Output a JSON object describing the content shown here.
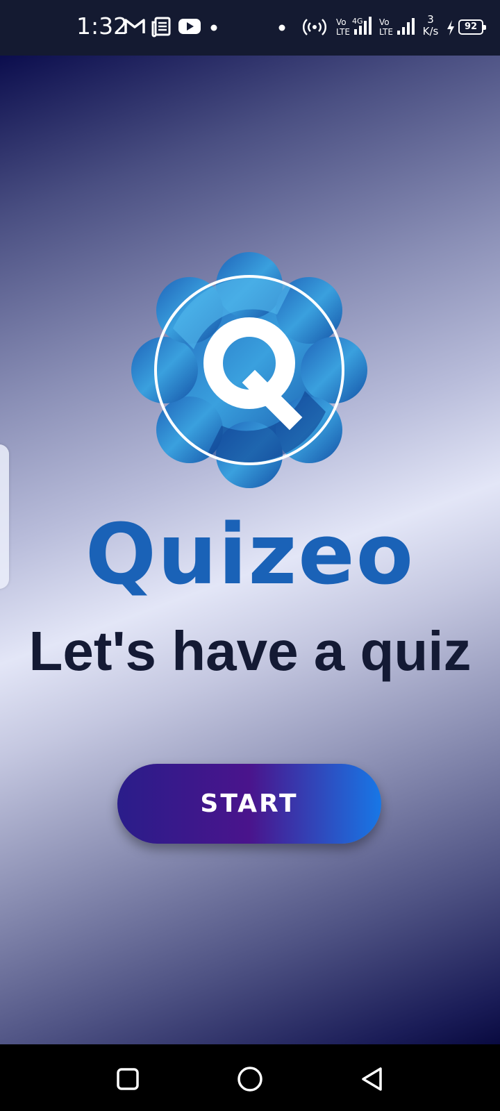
{
  "status_bar": {
    "time": "1:32",
    "net_speed_value": "3",
    "net_speed_unit": "K/s",
    "battery": "92",
    "icons": [
      "gmail-icon",
      "news-icon",
      "youtube-icon",
      "dot-icon",
      "dot-icon",
      "hotspot-icon",
      "volte-4g-signal-icon",
      "volte-signal-icon",
      "charging-icon",
      "battery-icon"
    ]
  },
  "app": {
    "brand": "Quizeo",
    "logo_letter": "Q",
    "headline": "Let's have a quiz",
    "start_label": "START",
    "colors": {
      "brand": "#1a62b7",
      "headline": "#141a34",
      "button_start": "#2a1d8a",
      "button_mid": "#4a148c",
      "button_end": "#1877e6"
    }
  },
  "nav_bar": {
    "icons": [
      "recent-apps-icon",
      "home-icon",
      "back-icon"
    ]
  }
}
